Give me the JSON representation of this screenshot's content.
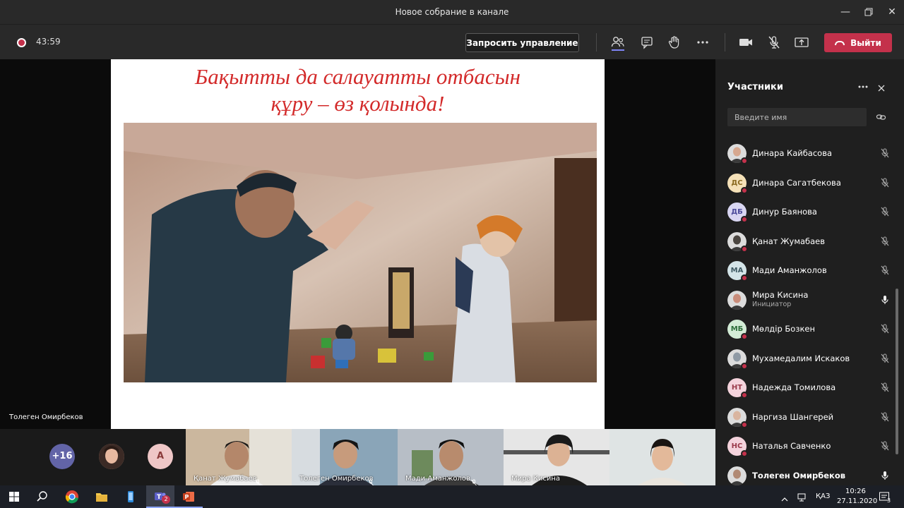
{
  "window": {
    "title": "Новое собрание в канале"
  },
  "toolbar": {
    "timer": "43:59",
    "request_control_label": "Запросить управление",
    "leave_label": "Выйти"
  },
  "slide": {
    "line1": "Бақытты да салауатты отбасын",
    "line2": "құру – өз қолында!"
  },
  "presenter_label": "Толеген Омирбеков",
  "strip": {
    "more_count": "+16",
    "avatar_initial": "А",
    "tiles": [
      {
        "name": "Қанат Жумабаев"
      },
      {
        "name": "Толеген Омирбеков"
      },
      {
        "name": "Мади Аманжолов"
      },
      {
        "name": "Мира Кисина"
      },
      {
        "name": ""
      }
    ]
  },
  "panel": {
    "title": "Участники",
    "search_placeholder": "Введите имя",
    "participants": [
      {
        "name": "Динара Кайбасова",
        "initials": "",
        "role": "",
        "mic": "muted"
      },
      {
        "name": "Динара Сагатбекова",
        "initials": "ДС",
        "role": "",
        "mic": "muted"
      },
      {
        "name": "Динур Баянова",
        "initials": "ДБ",
        "role": "",
        "mic": "muted"
      },
      {
        "name": "Қанат Жумабаев",
        "initials": "",
        "role": "",
        "mic": "muted"
      },
      {
        "name": "Мади Аманжолов",
        "initials": "МА",
        "role": "",
        "mic": "muted"
      },
      {
        "name": "Мира Кисина",
        "initials": "",
        "role": "Инициатор",
        "mic": "on"
      },
      {
        "name": "Мөлдір Бозкен",
        "initials": "МБ",
        "role": "",
        "mic": "muted"
      },
      {
        "name": "Мухамедалим Искаков",
        "initials": "",
        "role": "",
        "mic": "muted"
      },
      {
        "name": "Надежда Томилова",
        "initials": "НТ",
        "role": "",
        "mic": "muted"
      },
      {
        "name": "Наргиза Шангерей",
        "initials": "",
        "role": "",
        "mic": "muted"
      },
      {
        "name": "Наталья Савченко",
        "initials": "НС",
        "role": "",
        "mic": "muted"
      },
      {
        "name": "Толеген Омирбеков",
        "initials": "",
        "role": "",
        "mic": "on"
      }
    ]
  },
  "taskbar": {
    "lang": "ҚАЗ",
    "time": "10:26",
    "date": "27.11.2020",
    "notif_count": "3",
    "teams_badge": "2"
  },
  "colors": {
    "accent_red": "#c4314b",
    "brand_purple": "#6264a7",
    "slide_text": "#d32a2a"
  }
}
